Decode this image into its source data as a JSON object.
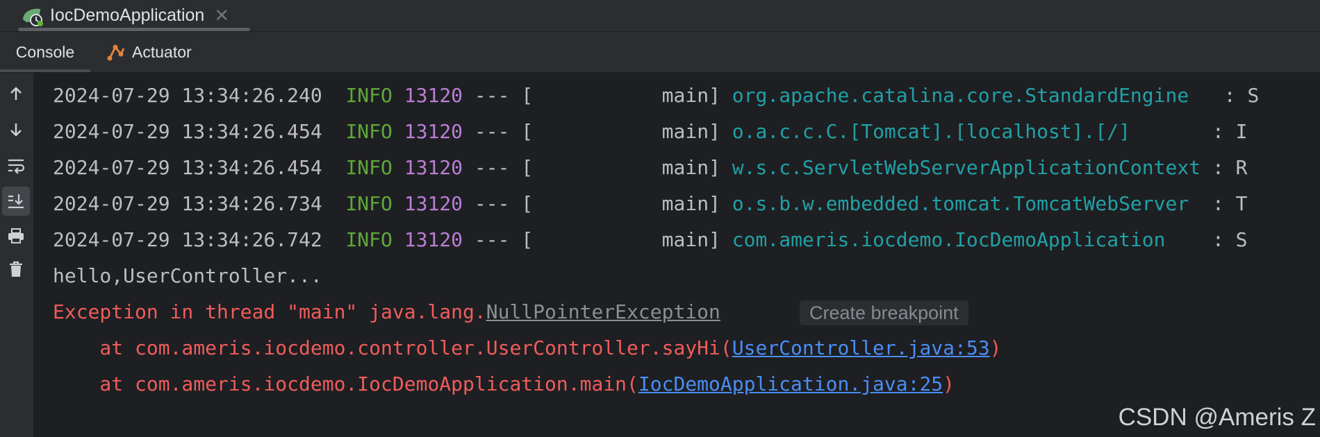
{
  "run_tab": {
    "title": "IocDemoApplication",
    "close": "✕",
    "icon": "spring-boot-run-icon"
  },
  "subtabs": [
    {
      "label": "Console"
    },
    {
      "label": "Actuator",
      "icon": "actuator-icon"
    }
  ],
  "gutter_icons": [
    "up-arrow-icon",
    "down-arrow-icon",
    "soft-wrap-icon",
    "scroll-to-end-icon",
    "print-icon",
    "clear-all-icon"
  ],
  "log_lines": [
    {
      "ts": "2024-07-29 13:34:26.240",
      "level": "INFO",
      "pid": "13120",
      "sep": "---",
      "thread": "[           main]",
      "logger": "org.apache.catalina.core.StandardEngine  ",
      "tail": ": S"
    },
    {
      "ts": "2024-07-29 13:34:26.454",
      "level": "INFO",
      "pid": "13120",
      "sep": "---",
      "thread": "[           main]",
      "logger": "o.a.c.c.C.[Tomcat].[localhost].[/]      ",
      "tail": ": I"
    },
    {
      "ts": "2024-07-29 13:34:26.454",
      "level": "INFO",
      "pid": "13120",
      "sep": "---",
      "thread": "[           main]",
      "logger": "w.s.c.ServletWebServerApplicationContext",
      "tail": ": R"
    },
    {
      "ts": "2024-07-29 13:34:26.734",
      "level": "INFO",
      "pid": "13120",
      "sep": "---",
      "thread": "[           main]",
      "logger": "o.s.b.w.embedded.tomcat.TomcatWebServer ",
      "tail": ": T"
    },
    {
      "ts": "2024-07-29 13:34:26.742",
      "level": "INFO",
      "pid": "13120",
      "sep": "---",
      "thread": "[           main]",
      "logger": "com.ameris.iocdemo.IocDemoApplication   ",
      "tail": ": S"
    }
  ],
  "stdout_line": "hello,UserController...",
  "exception": {
    "prefix": "Exception in thread \"main\" java.lang.",
    "class_link": "NullPointerException",
    "breakpoint_hint": "Create breakpoint"
  },
  "stack": [
    {
      "prefix": "    at com.ameris.iocdemo.controller.UserController.sayHi(",
      "link": "UserController.java:53",
      "suffix": ")"
    },
    {
      "prefix": "    at com.ameris.iocdemo.IocDemoApplication.main(",
      "link": "IocDemoApplication.java:25",
      "suffix": ")"
    }
  ],
  "watermark": "CSDN @Ameris Z",
  "colors": {
    "info": "#5fa83c",
    "pid": "#b97fd7",
    "logger": "#20a1a6",
    "error": "#f05c5c",
    "link": "#4a8ef5"
  }
}
